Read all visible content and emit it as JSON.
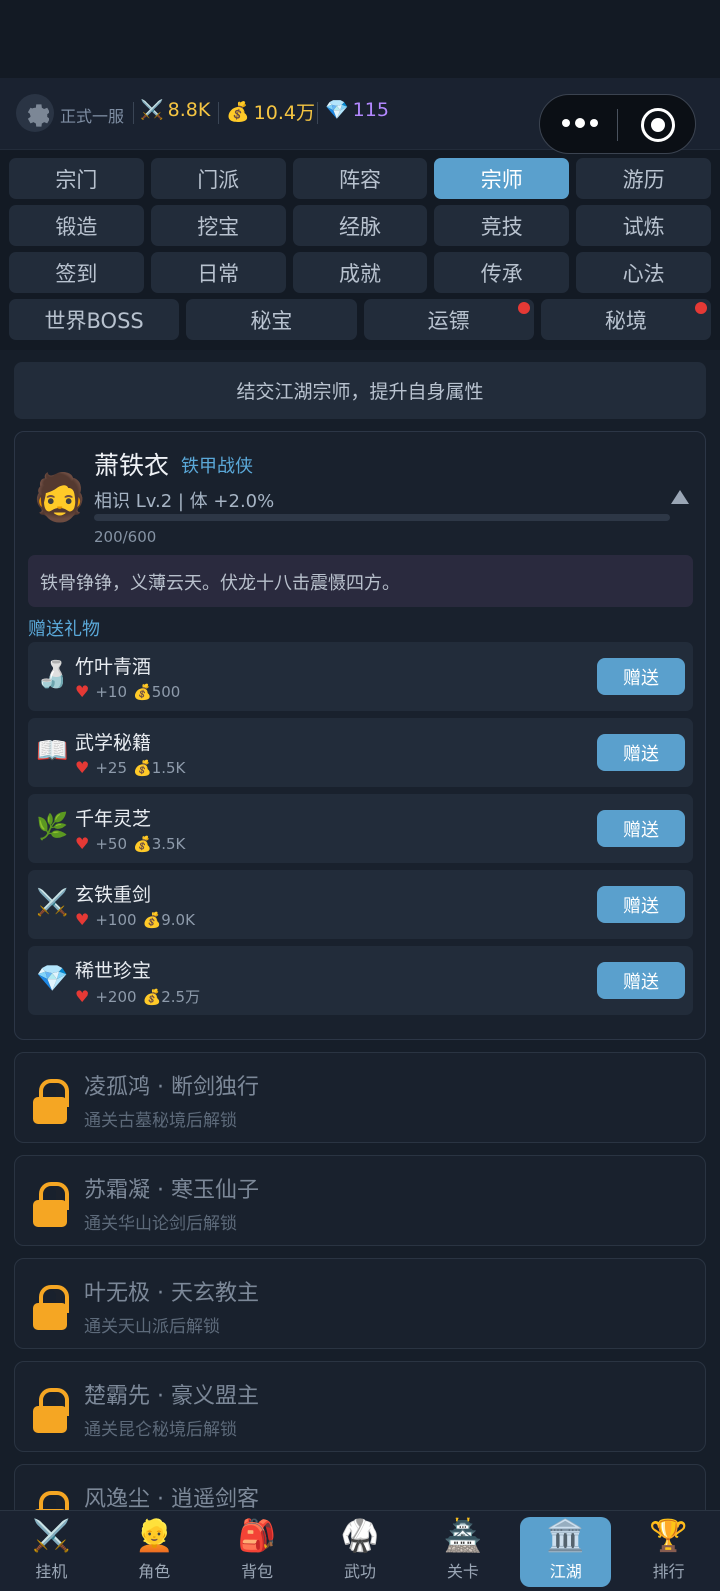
{
  "header": {
    "server": "正式一服",
    "power": "8.8K",
    "gold": "10.4万",
    "gems": "115",
    "power_icon": "⚔️",
    "gold_icon": "💰",
    "gem_icon": "💎"
  },
  "tabs": {
    "row1": [
      "宗门",
      "门派",
      "阵容",
      "宗师",
      "游历"
    ],
    "row2": [
      "锻造",
      "挖宝",
      "经脉",
      "竞技",
      "试炼"
    ],
    "row3": [
      "签到",
      "日常",
      "成就",
      "传承",
      "心法"
    ],
    "row4": [
      "世界BOSS",
      "秘宝",
      "运镖",
      "秘境"
    ],
    "active": "宗师"
  },
  "banner": "结交江湖宗师，提升自身属性",
  "master": {
    "avatar": "🧔",
    "name": "萧铁衣",
    "title": "铁甲战侠",
    "level": "相识 Lv.2 | 体 +2.0%",
    "progress_text": "200/600",
    "progress_fraction": 0.0,
    "quote": "铁骨铮铮，义薄云天。伏龙十八击震慑四方。",
    "gift_heading": "赠送礼物"
  },
  "gifts": [
    {
      "icon": "🍶",
      "name": "竹叶青酒",
      "favor": "+10",
      "cost": "500",
      "button": "赠送"
    },
    {
      "icon": "📖",
      "name": "武学秘籍",
      "favor": "+25",
      "cost": "1.5K",
      "button": "赠送"
    },
    {
      "icon": "🌿",
      "name": "千年灵芝",
      "favor": "+50",
      "cost": "3.5K",
      "button": "赠送"
    },
    {
      "icon": "⚔️",
      "name": "玄铁重剑",
      "favor": "+100",
      "cost": "9.0K",
      "button": "赠送"
    },
    {
      "icon": "💎",
      "name": "稀世珍宝",
      "favor": "+200",
      "cost": "2.5万",
      "button": "赠送"
    }
  ],
  "locked_masters": [
    {
      "name": "凌孤鸿 · 断剑独行",
      "condition": "通关古墓秘境后解锁"
    },
    {
      "name": "苏霜凝 · 寒玉仙子",
      "condition": "通关华山论剑后解锁"
    },
    {
      "name": "叶无极 · 天玄教主",
      "condition": "通关天山派后解锁"
    },
    {
      "name": "楚霸先 · 豪义盟主",
      "condition": "通关昆仑秘境后解锁"
    },
    {
      "name": "风逸尘 · 逍遥剑客",
      "condition": ""
    }
  ],
  "nav": [
    {
      "icon": "⚔️",
      "label": "挂机"
    },
    {
      "icon": "👱",
      "label": "角色"
    },
    {
      "icon": "🎒",
      "label": "背包"
    },
    {
      "icon": "🥋",
      "label": "武功"
    },
    {
      "icon": "🏯",
      "label": "关卡"
    },
    {
      "icon": "🏛️",
      "label": "江湖"
    },
    {
      "icon": "🏆",
      "label": "排行"
    }
  ],
  "colors": {
    "accent": "#5aa0cd",
    "gold": "#f5c542",
    "gem": "#b388ff",
    "badge": "#e53935",
    "lock": "#f5a623"
  }
}
